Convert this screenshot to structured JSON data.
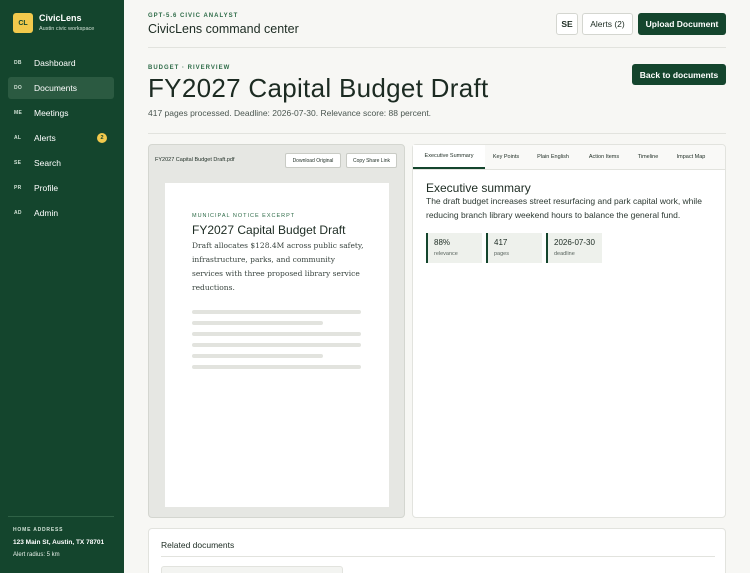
{
  "brand": {
    "logo": "CL",
    "name": "CivicLens",
    "subtitle": "Austin civic workspace"
  },
  "sidebar": {
    "items": [
      {
        "abbr": "DB",
        "label": "Dashboard"
      },
      {
        "abbr": "DO",
        "label": "Documents",
        "active": true
      },
      {
        "abbr": "ME",
        "label": "Meetings"
      },
      {
        "abbr": "AL",
        "label": "Alerts",
        "badge": "2"
      },
      {
        "abbr": "SE",
        "label": "Search"
      },
      {
        "abbr": "PR",
        "label": "Profile"
      },
      {
        "abbr": "AD",
        "label": "Admin"
      }
    ],
    "home": {
      "label": "HOME ADDRESS",
      "address": "123 Main St, Austin, TX 78701",
      "radius": "Alert radius: 5 km"
    }
  },
  "header": {
    "kicker": "GPT-5.6 CIVIC ANALYST",
    "title": "CivicLens command center",
    "avatar_label": "SE",
    "alerts_label": "Alerts (2)",
    "upload_label": "Upload Document"
  },
  "document": {
    "kicker": "BUDGET · RIVERVIEW",
    "title": "FY2027 Capital Budget Draft",
    "meta": "417 pages processed. Deadline: 2026-07-30. Relevance score: 88 percent.",
    "back_label": "Back to documents"
  },
  "viewer": {
    "file_name": "FY2027 Capital Budget Draft.pdf",
    "download_label": "Download Original",
    "copy_label": "Copy Share Link",
    "page": {
      "kicker": "MUNICIPAL NOTICE EXCERPT",
      "title": "FY2027 Capital Budget Draft",
      "body": "Draft allocates $128.4M across public safety, infrastructure, parks, and community services with three proposed library service reductions."
    }
  },
  "summary": {
    "tabs": [
      "Executive Summary",
      "Key Points",
      "Plain English",
      "Action Items",
      "Timeline",
      "Impact Map"
    ],
    "active_tab": "Executive Summary",
    "heading": "Executive summary",
    "text": "The draft budget increases street resurfacing and park capital work, while reducing branch library weekend hours to balance the general fund.",
    "stats": [
      {
        "value": "88%",
        "label": "relevance"
      },
      {
        "value": "417",
        "label": "pages"
      },
      {
        "value": "2026-07-30",
        "label": "deadline"
      }
    ]
  },
  "related": {
    "title": "Related documents"
  },
  "colors": {
    "sidebar": "#14452d",
    "accent": "#2d6b47",
    "badge": "#f2c94c"
  }
}
